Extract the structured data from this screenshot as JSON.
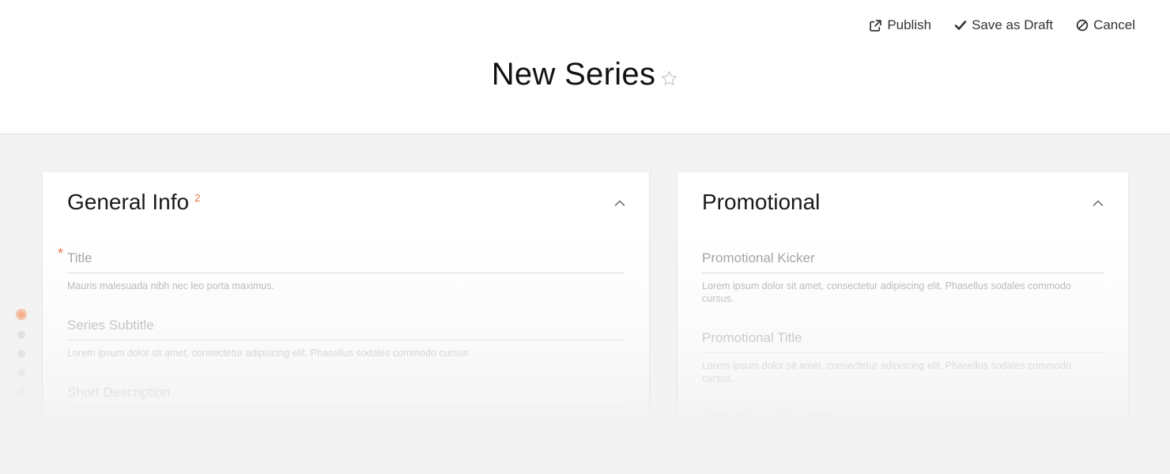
{
  "header": {
    "title": "New Series",
    "actions": {
      "publish_label": "Publish",
      "save_draft_label": "Save as Draft",
      "cancel_label": "Cancel"
    }
  },
  "sections": {
    "general": {
      "title": "General Info",
      "badge": "2",
      "fields": [
        {
          "label": "Title",
          "required": "*",
          "help": "Mauris malesuada nibh nec leo porta maximus."
        },
        {
          "label": "Series Subtitle",
          "help": "Lorem ipsum dolor sit amet, consectetur adipiscing elit. Phasellus sodales commodo cursus"
        },
        {
          "label": "Short Description"
        }
      ]
    },
    "promotional": {
      "title": "Promotional",
      "fields": [
        {
          "label": "Promotional Kicker",
          "help": "Lorem ipsum dolor sit amet, consectetur adipiscing elit. Phasellus sodales commodo cursus."
        },
        {
          "label": "Promotional Title",
          "help": "Lorem ipsum dolor sit amet, consectetur adipiscing elit. Phasellus sodales commodo cursus."
        },
        {
          "label": "Promotional Description"
        }
      ]
    }
  },
  "section_nav": {
    "count": 5,
    "active_index": 0
  },
  "icons": {
    "publish": "external-link-icon",
    "save_draft": "check-icon",
    "cancel": "ban-icon",
    "favorite": "star-outline-icon",
    "collapse": "chevron-up-icon"
  },
  "colors": {
    "accent": "#e8703c",
    "active_dot": "#f7b08e"
  }
}
